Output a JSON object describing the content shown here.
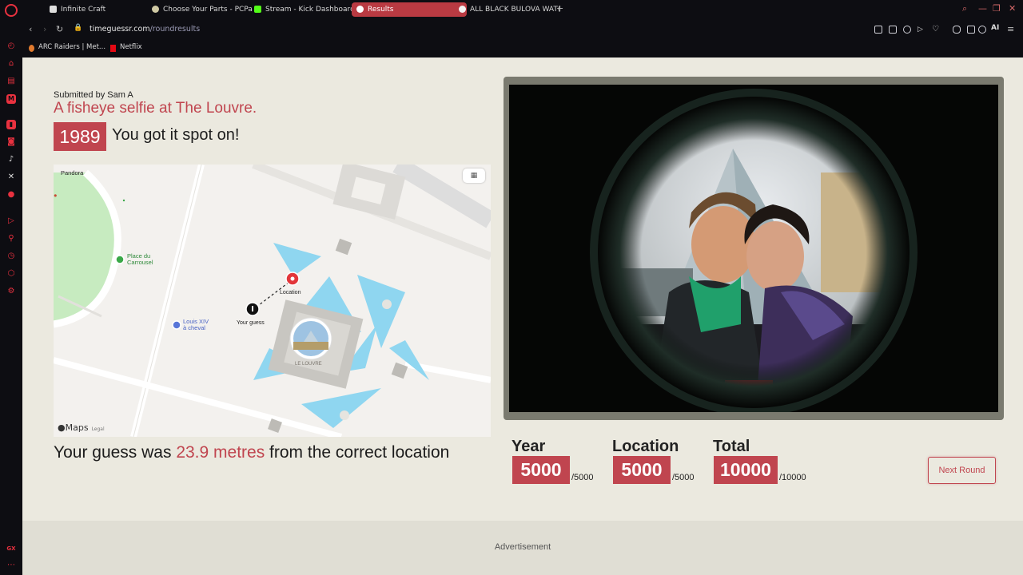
{
  "browser": {
    "tabs": [
      {
        "label": "Infinite Craft",
        "active": false
      },
      {
        "label": "Choose Your Parts - PCPa",
        "active": false
      },
      {
        "label": "Stream - Kick Dashboard",
        "active": false
      },
      {
        "label": "Results",
        "active": true
      },
      {
        "label": "ALL BLACK BULOVA WAT(",
        "active": false
      }
    ],
    "url_host": "timeguessr.com",
    "url_path": "/roundresults",
    "ai_label": "AI",
    "bookmarks": [
      {
        "label": "ARC Raiders | Met..."
      },
      {
        "label": "Netflix"
      }
    ],
    "sidebar_bottom_label": "GX",
    "accent": "#e8313f"
  },
  "result": {
    "submitted_by": "Submitted by Sam A",
    "title": "A fisheye selfie at The Louvre.",
    "year": "1989",
    "verdict": "You got it spot on!",
    "guess_prefix": "Your guess was ",
    "distance": "23.9 metres",
    "guess_suffix": " from the correct location"
  },
  "map": {
    "labels": {
      "pandora": "Pandora",
      "carrousel_1": "Place du",
      "carrousel_2": "Carrousel",
      "louis_1": "Louis XIV",
      "louis_2": "à cheval",
      "location_pin": "Location",
      "your_guess_pin": "Your guess",
      "louvre": "LE LOUVRE"
    },
    "attribution": "Maps",
    "legal": "Legal"
  },
  "scores": [
    {
      "label": "Year",
      "value": "5000",
      "max": "/5000"
    },
    {
      "label": "Location",
      "value": "5000",
      "max": "/5000"
    },
    {
      "label": "Total",
      "value": "10000",
      "max": "/10000"
    }
  ],
  "next_round_label": "Next Round",
  "advertisement_label": "Advertisement",
  "colors": {
    "brand": "#c0454f",
    "page_bg": "#ebe9df"
  }
}
